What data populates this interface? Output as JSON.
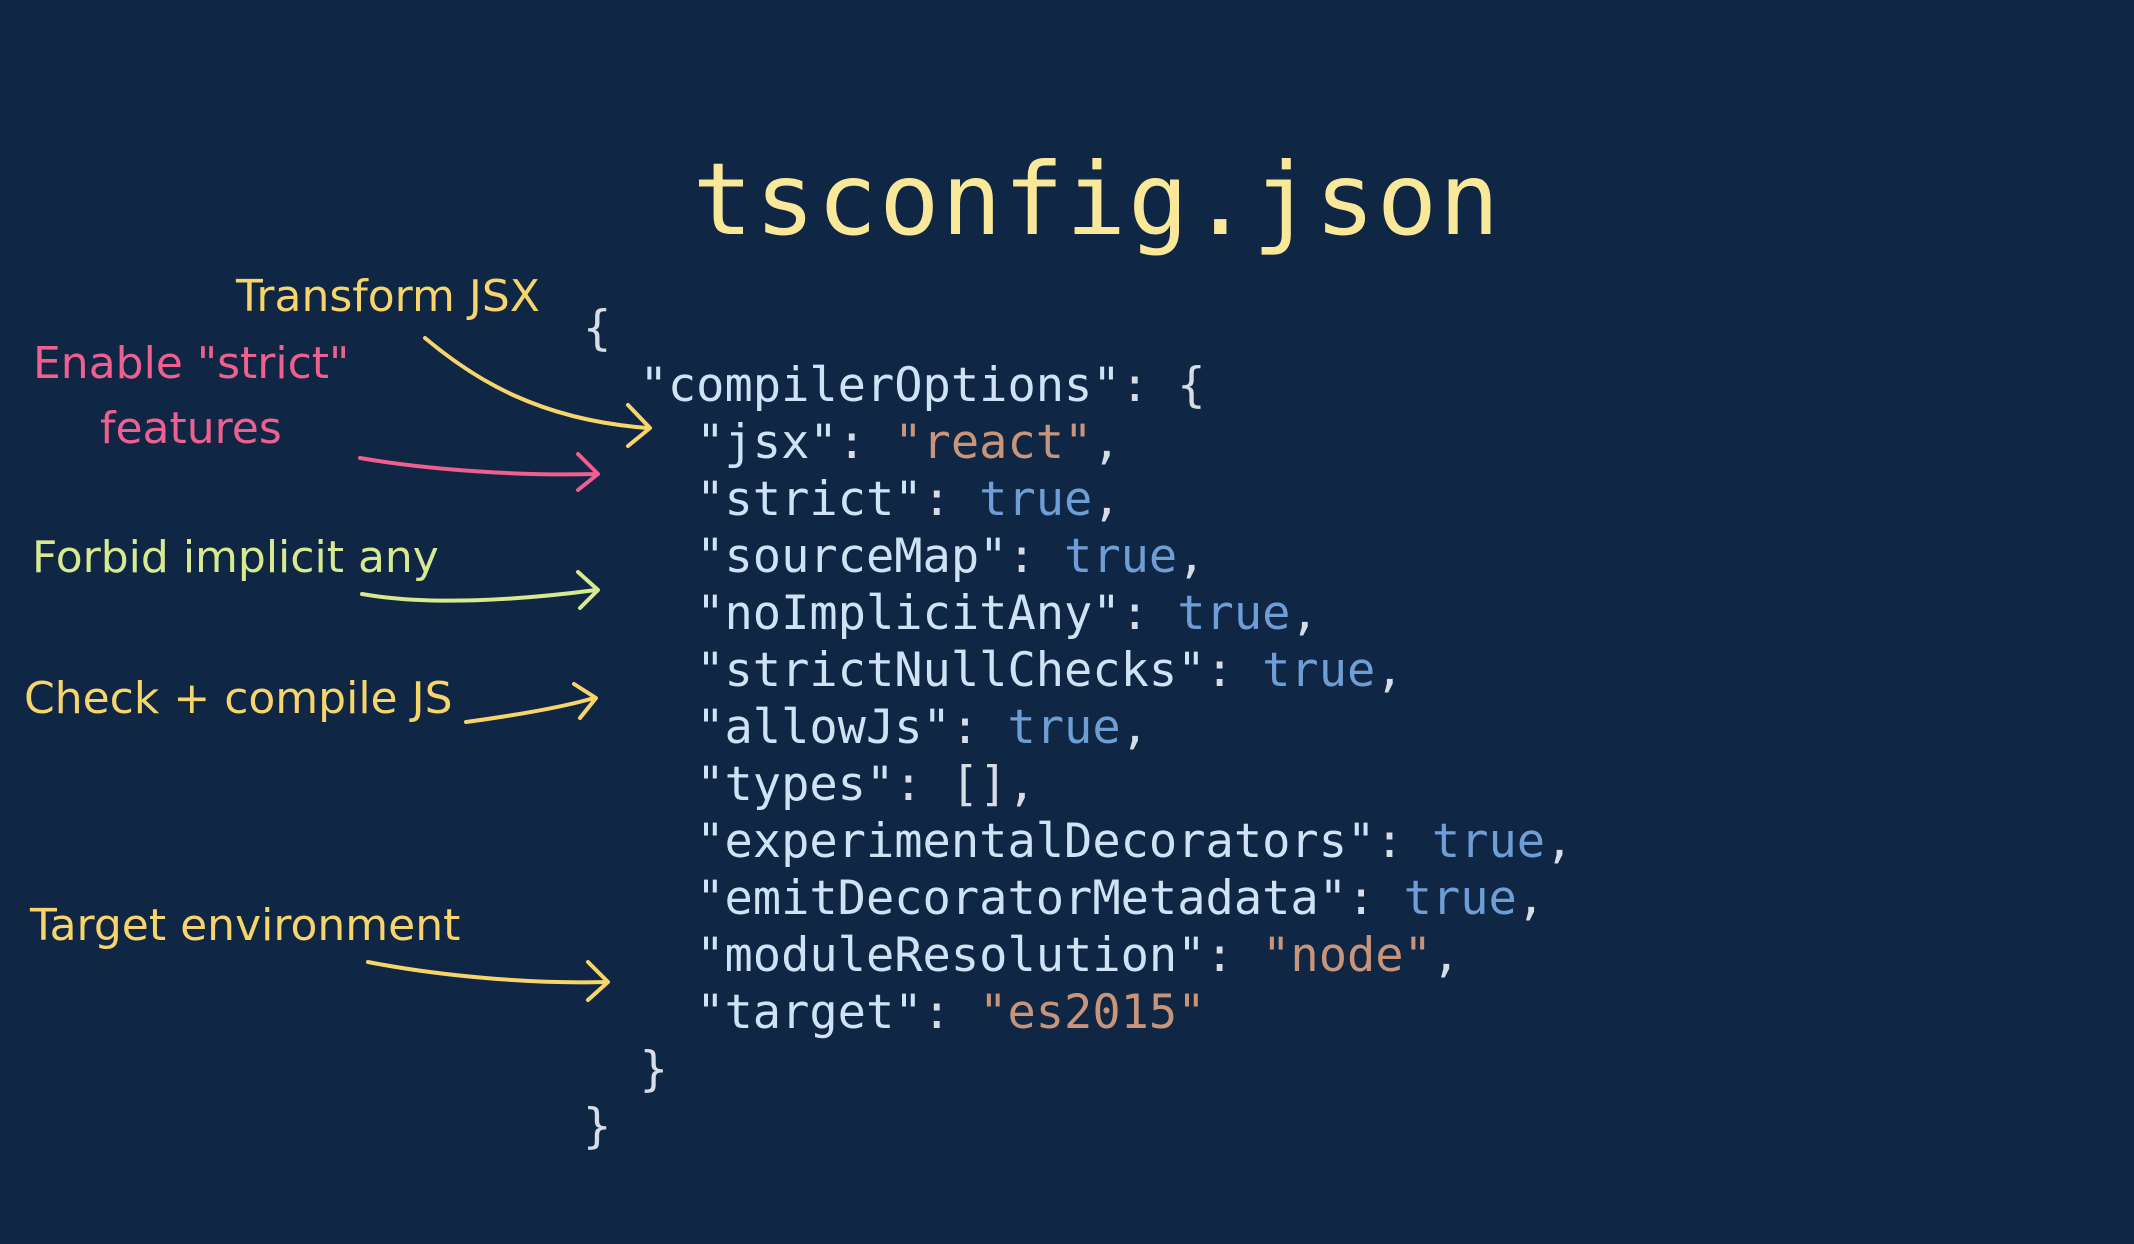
{
  "title": "tsconfig.json",
  "colors": {
    "background": "#0f2744",
    "title": "#f9e79a",
    "key": "#cfe3f5",
    "punct": "#d7dde6",
    "bool": "#6f9ed6",
    "string": "#c9957a",
    "annotation_yellow": "#f7d56b",
    "annotation_pink": "#ef5f8f",
    "annotation_green": "#d7ea8f"
  },
  "code": [
    [
      {
        "t": "{",
        "c": "punct"
      }
    ],
    [
      {
        "t": "  ",
        "c": "punct"
      },
      {
        "t": "\"compilerOptions\"",
        "c": "key"
      },
      {
        "t": ": {",
        "c": "punct"
      }
    ],
    [
      {
        "t": "    ",
        "c": "punct"
      },
      {
        "t": "\"jsx\"",
        "c": "key"
      },
      {
        "t": ": ",
        "c": "punct"
      },
      {
        "t": "\"react\"",
        "c": "string"
      },
      {
        "t": ",",
        "c": "punct"
      }
    ],
    [
      {
        "t": "    ",
        "c": "punct"
      },
      {
        "t": "\"strict\"",
        "c": "key"
      },
      {
        "t": ": ",
        "c": "punct"
      },
      {
        "t": "true",
        "c": "bool"
      },
      {
        "t": ",",
        "c": "punct"
      }
    ],
    [
      {
        "t": "    ",
        "c": "punct"
      },
      {
        "t": "\"sourceMap\"",
        "c": "key"
      },
      {
        "t": ": ",
        "c": "punct"
      },
      {
        "t": "true",
        "c": "bool"
      },
      {
        "t": ",",
        "c": "punct"
      }
    ],
    [
      {
        "t": "    ",
        "c": "punct"
      },
      {
        "t": "\"noImplicitAny\"",
        "c": "key"
      },
      {
        "t": ": ",
        "c": "punct"
      },
      {
        "t": "true",
        "c": "bool"
      },
      {
        "t": ",",
        "c": "punct"
      }
    ],
    [
      {
        "t": "    ",
        "c": "punct"
      },
      {
        "t": "\"strictNullChecks\"",
        "c": "key"
      },
      {
        "t": ": ",
        "c": "punct"
      },
      {
        "t": "true",
        "c": "bool"
      },
      {
        "t": ",",
        "c": "punct"
      }
    ],
    [
      {
        "t": "    ",
        "c": "punct"
      },
      {
        "t": "\"allowJs\"",
        "c": "key"
      },
      {
        "t": ": ",
        "c": "punct"
      },
      {
        "t": "true",
        "c": "bool"
      },
      {
        "t": ",",
        "c": "punct"
      }
    ],
    [
      {
        "t": "    ",
        "c": "punct"
      },
      {
        "t": "\"types\"",
        "c": "key"
      },
      {
        "t": ": [],",
        "c": "punct"
      }
    ],
    [
      {
        "t": "    ",
        "c": "punct"
      },
      {
        "t": "\"experimentalDecorators\"",
        "c": "key"
      },
      {
        "t": ": ",
        "c": "punct"
      },
      {
        "t": "true",
        "c": "bool"
      },
      {
        "t": ",",
        "c": "punct"
      }
    ],
    [
      {
        "t": "    ",
        "c": "punct"
      },
      {
        "t": "\"emitDecoratorMetadata\"",
        "c": "key"
      },
      {
        "t": ": ",
        "c": "punct"
      },
      {
        "t": "true",
        "c": "bool"
      },
      {
        "t": ",",
        "c": "punct"
      }
    ],
    [
      {
        "t": "    ",
        "c": "punct"
      },
      {
        "t": "\"moduleResolution\"",
        "c": "key"
      },
      {
        "t": ": ",
        "c": "punct"
      },
      {
        "t": "\"node\"",
        "c": "string"
      },
      {
        "t": ",",
        "c": "punct"
      }
    ],
    [
      {
        "t": "    ",
        "c": "punct"
      },
      {
        "t": "\"target\"",
        "c": "key"
      },
      {
        "t": ": ",
        "c": "punct"
      },
      {
        "t": "\"es2015\"",
        "c": "string"
      }
    ],
    [
      {
        "t": "  }",
        "c": "punct"
      }
    ],
    [
      {
        "t": "}",
        "c": "punct"
      }
    ]
  ],
  "annotations": {
    "transform_jsx": "Transform JSX",
    "enable_strict_line1": "Enable \"strict\"",
    "enable_strict_line2": "features",
    "forbid_implicit_any": "Forbid implicit any",
    "check_compile_js": "Check + compile JS",
    "target_environment": "Target environment"
  }
}
